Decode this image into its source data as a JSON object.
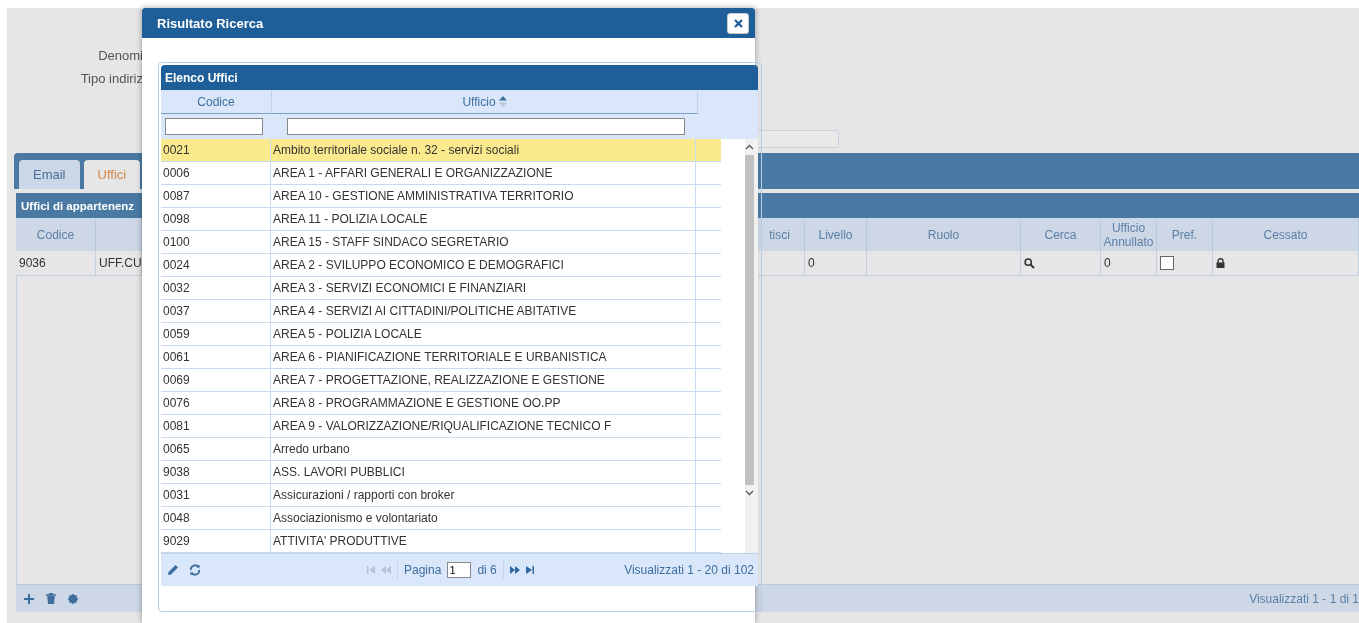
{
  "form": {
    "labels": [
      "Denomi",
      "Tipo indiriz"
    ]
  },
  "tabs": [
    {
      "label": "Email",
      "selected": false
    },
    {
      "label": "Uffici",
      "selected": true
    }
  ],
  "panel": {
    "title": "Uffici di appartenenz",
    "columns": [
      "Codice",
      "tisci",
      "Livello",
      "Ruolo",
      "Cerca",
      "Ufficio Annullato",
      "Pref.",
      "Cessato"
    ],
    "rows": [
      {
        "codice": "9036",
        "column_2": "UFF.CU",
        "livello": "0",
        "ruolo": "",
        "ufficio_annullato": "0",
        "pref": false,
        "cessato": true
      }
    ],
    "footer": "Visualizzati 1 - 1 di 1"
  },
  "dialog": {
    "title": "Risultato Ricerca",
    "grid_title": "Elenco Uffici",
    "columns": [
      "Codice",
      "Ufficio"
    ],
    "rows": [
      {
        "codice": "0021",
        "ufficio": "Ambito territoriale sociale n. 32 - servizi sociali",
        "selected": true
      },
      {
        "codice": "0006",
        "ufficio": "AREA 1 - AFFARI GENERALI E ORGANIZZAZIONE",
        "selected": false
      },
      {
        "codice": "0087",
        "ufficio": "AREA 10 - GESTIONE AMMINISTRATIVA TERRITORIO",
        "selected": false
      },
      {
        "codice": "0098",
        "ufficio": "AREA 11 - POLIZIA LOCALE",
        "selected": false
      },
      {
        "codice": "0100",
        "ufficio": "AREA 15 - STAFF  SINDACO SEGRETARIO",
        "selected": false
      },
      {
        "codice": "0024",
        "ufficio": "AREA 2 - SVILUPPO ECONOMICO E DEMOGRAFICI",
        "selected": false
      },
      {
        "codice": "0032",
        "ufficio": "AREA 3 - SERVIZI ECONOMICI E FINANZIARI",
        "selected": false
      },
      {
        "codice": "0037",
        "ufficio": "AREA 4 - SERVIZI AI CITTADINI/POLITICHE ABITATIVE",
        "selected": false
      },
      {
        "codice": "0059",
        "ufficio": "AREA 5 -  POLIZIA LOCALE",
        "selected": false
      },
      {
        "codice": "0061",
        "ufficio": "AREA 6 - PIANIFICAZIONE TERRITORIALE E URBANISTICA",
        "selected": false
      },
      {
        "codice": "0069",
        "ufficio": "AREA 7 - PROGETTAZIONE, REALIZZAZIONE E GESTIONE",
        "selected": false
      },
      {
        "codice": "0076",
        "ufficio": "AREA 8 - PROGRAMMAZIONE E GESTIONE OO.PP",
        "selected": false
      },
      {
        "codice": "0081",
        "ufficio": "AREA 9 - VALORIZZAZIONE/RIQUALIFICAZIONE TECNICO F",
        "selected": false
      },
      {
        "codice": "0065",
        "ufficio": "Arredo urbano",
        "selected": false
      },
      {
        "codice": "9038",
        "ufficio": "ASS. LAVORI PUBBLICI",
        "selected": false
      },
      {
        "codice": "0031",
        "ufficio": "Assicurazioni / rapporti con broker",
        "selected": false
      },
      {
        "codice": "0048",
        "ufficio": "Associazionismo e volontariato",
        "selected": false
      },
      {
        "codice": "9029",
        "ufficio": "ATTIVITA' PRODUTTIVE",
        "selected": false
      }
    ],
    "pager": {
      "label": "Pagina",
      "page": "1",
      "of": "di 6",
      "summary": "Visualizzati 1 - 20 di 102"
    }
  }
}
